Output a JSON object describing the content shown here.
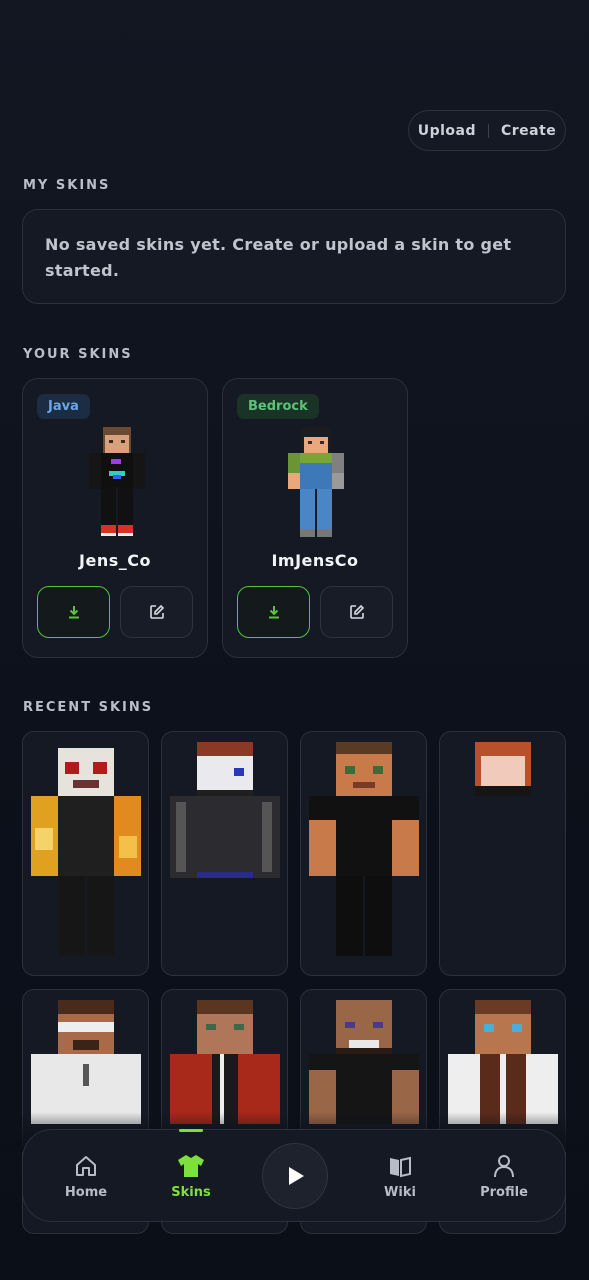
{
  "header": {
    "upload_label": "Upload",
    "create_label": "Create"
  },
  "my_skins": {
    "title": "MY SKINS",
    "empty_message": "No saved skins yet. Create or upload a skin to get started."
  },
  "your_skins": {
    "title": "YOUR SKINS",
    "items": [
      {
        "edition": "Java",
        "name": "Jens_Co"
      },
      {
        "edition": "Bedrock",
        "name": "ImJensCo"
      }
    ]
  },
  "recent_skins": {
    "title": "RECENT SKINS",
    "items": [
      "skin-1",
      "skin-2",
      "skin-3",
      "skin-4",
      "skin-5",
      "skin-6",
      "skin-7",
      "skin-8"
    ]
  },
  "bottom_nav": {
    "items": [
      {
        "label": "Home",
        "icon": "home-icon"
      },
      {
        "label": "Skins",
        "icon": "shirt-icon",
        "active": true
      },
      {
        "label": "",
        "icon": "play-icon"
      },
      {
        "label": "Wiki",
        "icon": "book-icon"
      },
      {
        "label": "Profile",
        "icon": "user-icon"
      }
    ]
  },
  "colors": {
    "accent": "#7ee03a",
    "java": "#6aa6e8",
    "bedrock": "#5cc27a",
    "background": "#0d111b"
  }
}
